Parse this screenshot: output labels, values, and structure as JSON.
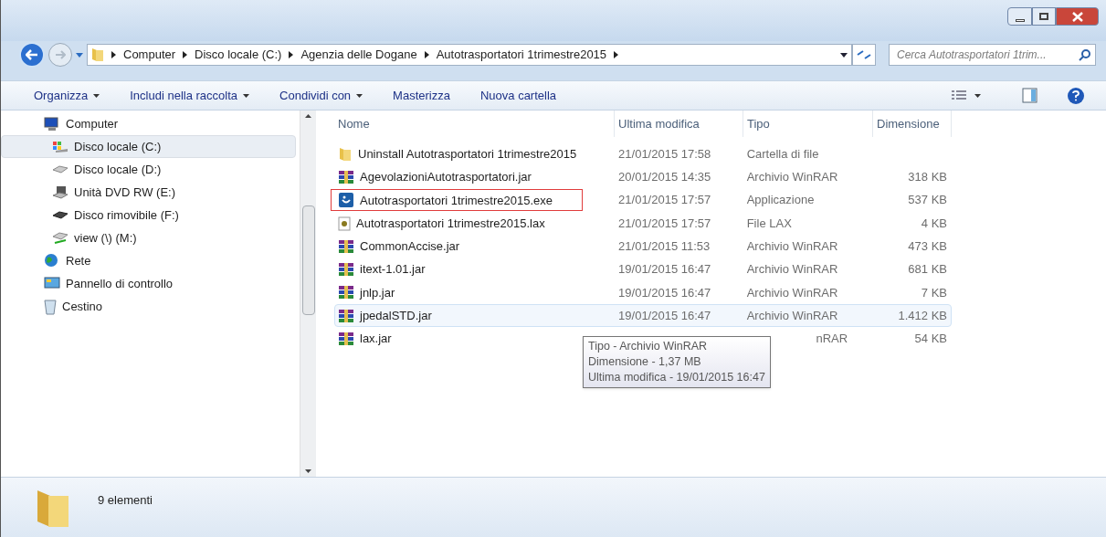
{
  "address": {
    "crumbs": [
      "Computer",
      "Disco locale (C:)",
      "Agenzia delle Dogane",
      "Autotrasportatori 1trimestre2015"
    ]
  },
  "search": {
    "placeholder": "Cerca Autotrasportatori 1trim..."
  },
  "toolbar": {
    "items": [
      {
        "label": "Organizza",
        "menu": true
      },
      {
        "label": "Includi nella raccolta",
        "menu": true
      },
      {
        "label": "Condividi con",
        "menu": true
      },
      {
        "label": "Masterizza",
        "menu": false
      },
      {
        "label": "Nuova cartella",
        "menu": false
      }
    ]
  },
  "sidebar": {
    "items": [
      {
        "label": "Computer",
        "kind": "computer",
        "selected": false,
        "children": [
          {
            "label": "Disco locale (C:)",
            "kind": "sysdrive",
            "selected": true
          },
          {
            "label": "Disco locale (D:)",
            "kind": "drive",
            "selected": false
          },
          {
            "label": "Unità DVD RW (E:)",
            "kind": "dvd",
            "selected": false
          },
          {
            "label": "Disco rimovibile (F:)",
            "kind": "removable",
            "selected": false
          },
          {
            "label": "view (\\) (M:)",
            "kind": "netdrive",
            "selected": false
          }
        ]
      },
      {
        "label": "Rete",
        "kind": "network",
        "selected": false
      },
      {
        "label": "Pannello di controllo",
        "kind": "control",
        "selected": false
      },
      {
        "label": "Cestino",
        "kind": "trash",
        "selected": false
      }
    ]
  },
  "table": {
    "columns": [
      "Nome",
      "Ultima modifica",
      "Tipo",
      "Dimensione"
    ],
    "rows": [
      {
        "kind": "folder",
        "name": "Uninstall Autotrasportatori 1trimestre2015",
        "modified": "21/01/2015 17:58",
        "type": "Cartella di file",
        "hovered": false,
        "marked": false
      },
      {
        "kind": "archive",
        "name": "AgevolazioniAutotrasportatori.jar",
        "modified": "20/01/2015 14:35",
        "type": "Archivio WinRAR",
        "size": "318 KB",
        "hovered": false,
        "marked": false
      },
      {
        "kind": "exe",
        "name": "Autotrasportatori 1trimestre2015.exe",
        "modified": "21/01/2015 17:57",
        "type": "Applicazione",
        "size": "537 KB",
        "hovered": false,
        "marked": true
      },
      {
        "kind": "lax",
        "name": "Autotrasportatori 1trimestre2015.lax",
        "modified": "21/01/2015 17:57",
        "type": "File LAX",
        "size": "4 KB",
        "hovered": false,
        "marked": false
      },
      {
        "kind": "archive",
        "name": "CommonAccise.jar",
        "modified": "21/01/2015 11:53",
        "type": "Archivio WinRAR",
        "size": "473 KB",
        "hovered": false,
        "marked": false
      },
      {
        "kind": "archive",
        "name": "itext-1.01.jar",
        "modified": "19/01/2015 16:47",
        "type": "Archivio WinRAR",
        "size": "681 KB",
        "hovered": false,
        "marked": false
      },
      {
        "kind": "archive",
        "name": "jnlp.jar",
        "modified": "19/01/2015 16:47",
        "type": "Archivio WinRAR",
        "size": "7 KB",
        "hovered": false,
        "marked": false
      },
      {
        "kind": "archive",
        "name": "jpedalSTD.jar",
        "modified": "19/01/2015 16:47",
        "type": "Archivio WinRAR",
        "size": "1.412 KB",
        "hovered": true,
        "marked": false
      },
      {
        "kind": "archive",
        "name": "lax.jar",
        "type": "nRAR",
        "size": "54 KB",
        "hovered": false,
        "marked": false
      }
    ]
  },
  "tooltip": {
    "lines": [
      "Tipo - Archivio WinRAR",
      "Dimensione - 1,37 MB",
      "Ultima modifica - 19/01/2015 16:47"
    ]
  },
  "status_bar": {
    "text": "9 elementi"
  }
}
